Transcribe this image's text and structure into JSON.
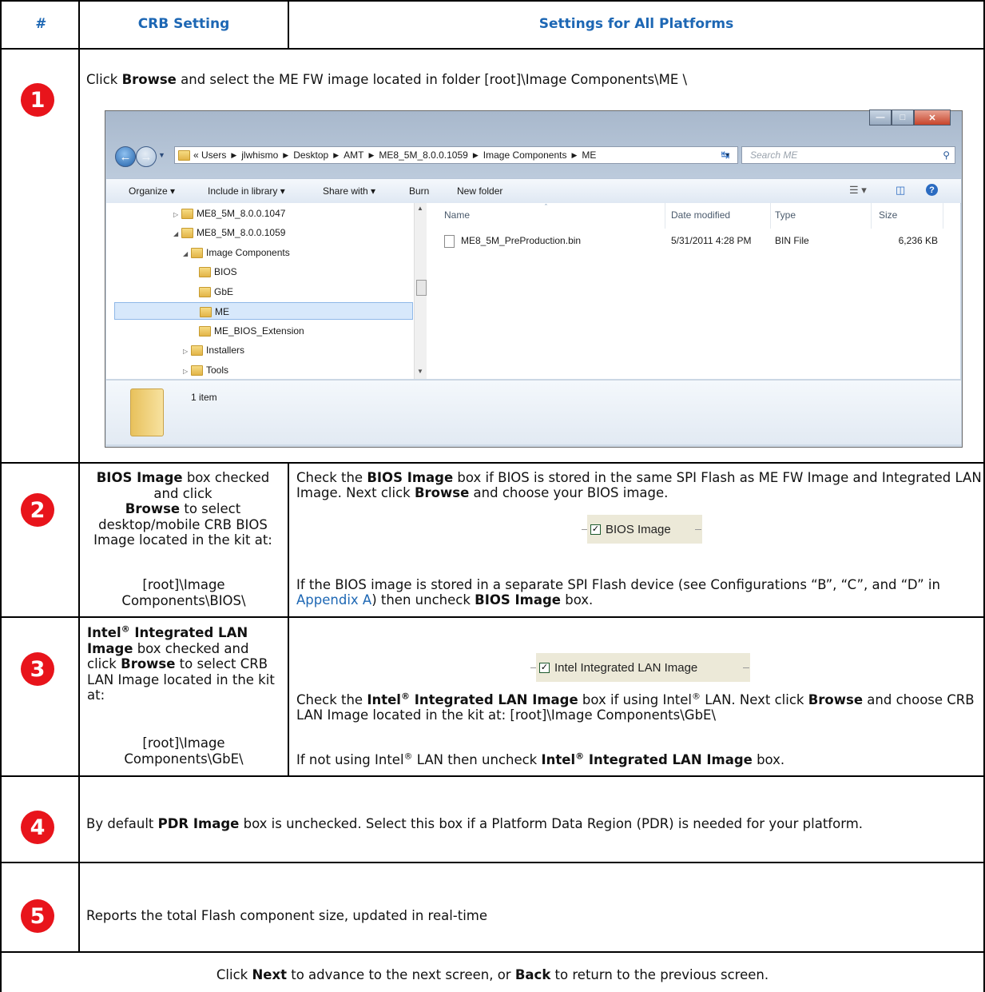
{
  "header": {
    "col1": "#",
    "col2": "CRB Setting",
    "col3": "Settings for All Platforms"
  },
  "rows": [
    {
      "num": "1",
      "text_pre": "Click ",
      "text_bold": "Browse",
      "text_post": " and select the ME FW image located in folder [root]\\Image Components\\ME \\"
    },
    {
      "num": "2",
      "left": {
        "b1": "BIOS Image",
        "t1": " box checked and click",
        "b2": "Browse",
        "t2": " to select desktop/mobile CRB BIOS Image located in the kit at:",
        "path": "[root]\\Image Components\\BIOS\\"
      },
      "right": {
        "p1_a": "Check the ",
        "p1_b": "BIOS Image",
        "p1_c": " box if BIOS is stored in the same SPI Flash as ME FW Image and Integrated LAN Image. Next click ",
        "p1_d": "Browse",
        "p1_e": " and choose your BIOS image.",
        "checkbox_label": "BIOS Image",
        "p2_a": "If the BIOS image is stored in a separate SPI Flash device (see Configurations “B”, “C”, and “D” in ",
        "p2_link": "Appendix A",
        "p2_b": ") then uncheck ",
        "p2_c": "BIOS Image",
        "p2_d": " box."
      }
    },
    {
      "num": "3",
      "left": {
        "b1": "Intel",
        "reg": "®",
        "b2": " Integrated LAN Image",
        "t1": " box checked and click ",
        "b3": "Browse",
        "t2": " to select CRB LAN Image located in the kit at:",
        "path": "[root]\\Image Components\\GbE\\"
      },
      "right": {
        "checkbox_label": "Intel Integrated LAN Image",
        "p1_a": "Check the ",
        "p1_b": "Intel",
        "p1_reg": "®",
        "p1_c": " Integrated LAN Image",
        "p1_d": " box if using Intel",
        "p1_reg2": "®",
        "p1_e": " LAN. Next click ",
        "p1_f": "Browse",
        "p1_g": " and choose CRB LAN Image located in the kit at: [root]\\Image Components\\GbE\\",
        "p2_a": "If not using Intel",
        "p2_reg": "®",
        "p2_b": " LAN then uncheck ",
        "p2_c": "Intel",
        "p2_reg2": "®",
        "p2_d": " Integrated LAN Image",
        "p2_e": " box."
      }
    },
    {
      "num": "4",
      "text_pre": "By default ",
      "text_bold": "PDR Image",
      "text_post": " box is unchecked. Select this box if a Platform Data Region (PDR) is needed for your platform."
    },
    {
      "num": "5",
      "text": "Reports the total Flash component size, updated in real-time"
    }
  ],
  "footer": {
    "a": "Click ",
    "b": "Next",
    "c": " to advance to the next screen, or ",
    "d": "Back",
    "e": " to return to the previous screen."
  },
  "explorer": {
    "breadcrumb": [
      "« Users",
      "jlwhismo",
      "Desktop",
      "AMT",
      "ME8_5M_8.0.0.1059",
      "Image Components",
      "ME"
    ],
    "search_placeholder": "Search ME",
    "toolbar": [
      "Organize ▾",
      "Include in library ▾",
      "Share with ▾",
      "Burn",
      "New folder"
    ],
    "tree": [
      "ME8_5M_8.0.0.1047",
      "ME8_5M_8.0.0.1059",
      "Image Components",
      "BIOS",
      "GbE",
      "ME",
      "ME_BIOS_Extension",
      "Installers",
      "Tools"
    ],
    "columns": [
      "Name",
      "Date modified",
      "Type",
      "Size"
    ],
    "file": {
      "name": "ME8_5M_PreProduction.bin",
      "date": "5/31/2011 4:28 PM",
      "type": "BIN File",
      "size": "6,236 KB"
    },
    "status": "1 item"
  }
}
